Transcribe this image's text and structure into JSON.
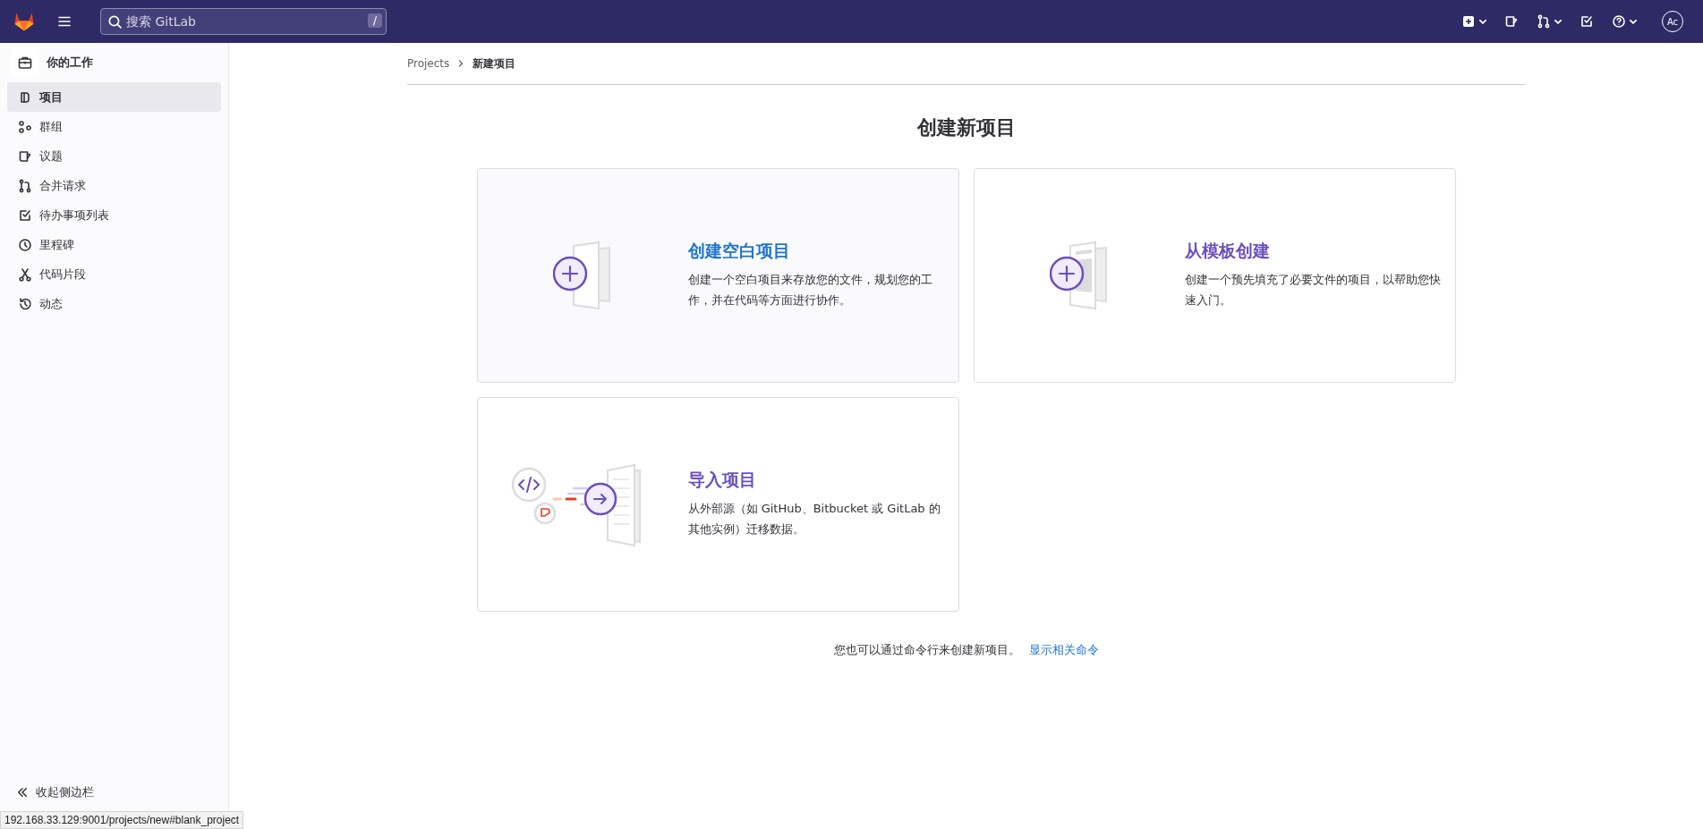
{
  "top_bar": {
    "search": {
      "placeholder": "搜索 GitLab",
      "shortcut": "/"
    },
    "actions": [
      {
        "kind": "new",
        "menu": true
      },
      {
        "kind": "issues",
        "menu": false
      },
      {
        "kind": "merge",
        "menu": true
      },
      {
        "kind": "todo",
        "menu": false
      },
      {
        "kind": "help",
        "menu": true
      }
    ],
    "avatar": "Ac"
  },
  "sidebar": {
    "title": "你的工作",
    "items": [
      {
        "label": "项目",
        "kind": "project",
        "selected": true
      },
      {
        "label": "群组",
        "kind": "group",
        "selected": false
      },
      {
        "label": "议题",
        "kind": "issue",
        "selected": false
      },
      {
        "label": "合并请求",
        "kind": "merge",
        "selected": false
      },
      {
        "label": "待办事项列表",
        "kind": "todo",
        "selected": false
      },
      {
        "label": "里程碑",
        "kind": "clock",
        "selected": false
      },
      {
        "label": "代码片段",
        "kind": "snippet",
        "selected": false
      },
      {
        "label": "动态",
        "kind": "history",
        "selected": false
      }
    ],
    "collapse": "收起侧边栏"
  },
  "breadcrumb": [
    "Projects",
    "新建项目"
  ],
  "title": "创建新项目",
  "cards": [
    {
      "kind": "blank",
      "title": "创建空白项目",
      "description": "创建一个空白项目来存放您的文件，规划您的工作，并在代码等方面进行协作。",
      "highlighted": true
    },
    {
      "kind": "template",
      "title": "从模板创建",
      "description": "创建一个预先填充了必要文件的项目，以帮助您快速入门。",
      "highlighted": false
    },
    {
      "kind": "import",
      "title": "导入项目",
      "description": "从外部源（如 GitHub、Bitbucket 或 GitLab 的其他实例）迁移数据。",
      "highlighted": false
    }
  ],
  "footer": {
    "text": "您也可以通过命令行来创建新项目。",
    "link": "显示相关命令"
  },
  "status_url": "192.168.33.129:9001/projects/new#blank_project"
}
